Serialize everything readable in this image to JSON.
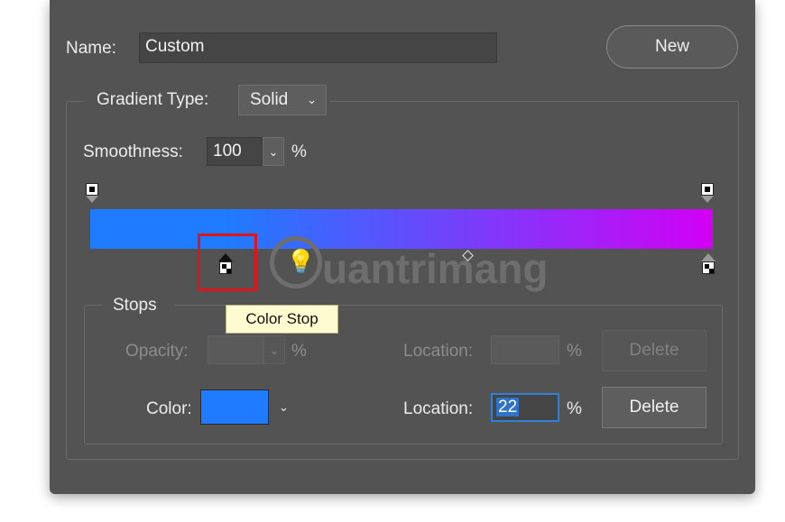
{
  "name": {
    "label": "Name:",
    "value": "Custom"
  },
  "new_button": "New",
  "gradient_type": {
    "label": "Gradient Type:",
    "value": "Solid"
  },
  "smoothness": {
    "label": "Smoothness:",
    "value": "100",
    "unit": "%"
  },
  "gradient": {
    "start_color": "#1f7bff",
    "end_color": "#d200f5",
    "color_stops": [
      {
        "location": 22,
        "color": "#1f7bff",
        "selected": true
      },
      {
        "location": 100,
        "color": "#d200f5",
        "selected": false
      }
    ],
    "opacity_stops": [
      0,
      100
    ],
    "midpoint": 60
  },
  "tooltip": "Color Stop",
  "watermark": "uantrimang",
  "stops": {
    "title": "Stops",
    "opacity": {
      "label": "Opacity:",
      "unit": "%",
      "location_label": "Location:",
      "location_unit": "%",
      "delete": "Delete"
    },
    "color": {
      "label": "Color:",
      "swatch": "#1f7bff",
      "location_label": "Location:",
      "location_value": "22",
      "location_unit": "%",
      "delete": "Delete"
    }
  }
}
